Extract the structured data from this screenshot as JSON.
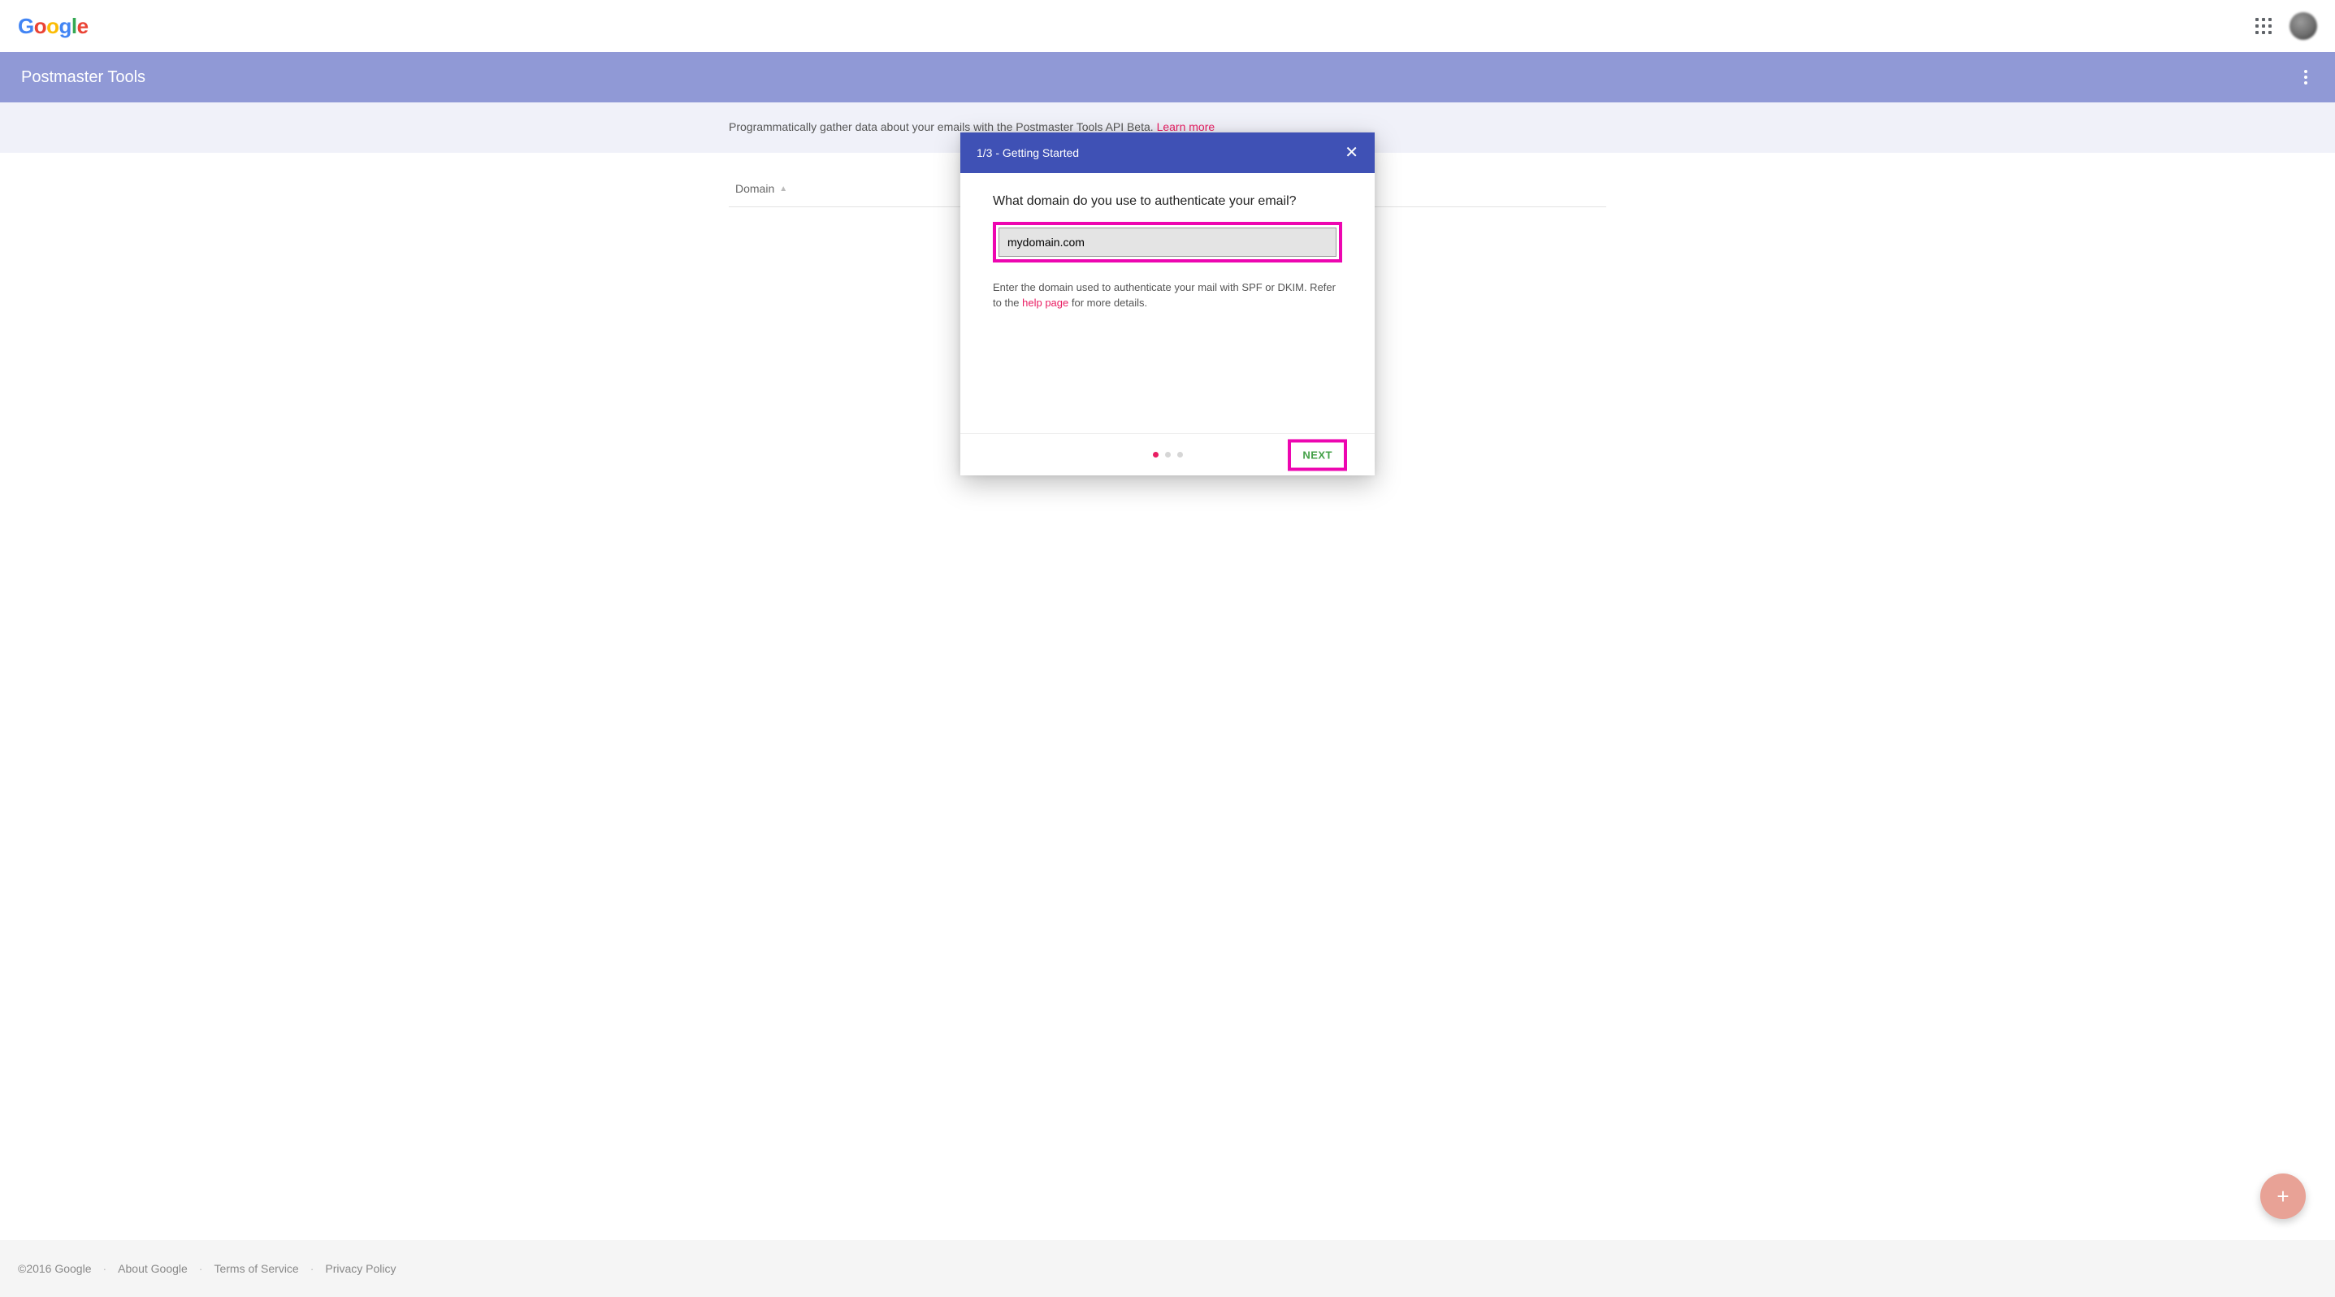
{
  "header": {
    "logo_letters": [
      "G",
      "o",
      "o",
      "g",
      "l",
      "e"
    ]
  },
  "appbar": {
    "title": "Postmaster Tools"
  },
  "banner": {
    "text_before_link": "Programmatically gather data about your emails with the Postmaster Tools API Beta. ",
    "link_text": "Learn more"
  },
  "table": {
    "column_label": "Domain"
  },
  "modal": {
    "step_label": "1/3 - Getting Started",
    "question": "What domain do you use to authenticate your email?",
    "input_value": "mydomain.com",
    "hint_before": "Enter the domain used to authenticate your mail with SPF or DKIM. Refer to the ",
    "hint_link": "help page",
    "hint_after": " for more details.",
    "next_label": "NEXT",
    "total_steps": 3,
    "active_step": 1
  },
  "footer": {
    "copyright": "©2016 Google",
    "links": [
      "About Google",
      "Terms of Service",
      "Privacy Policy"
    ]
  }
}
